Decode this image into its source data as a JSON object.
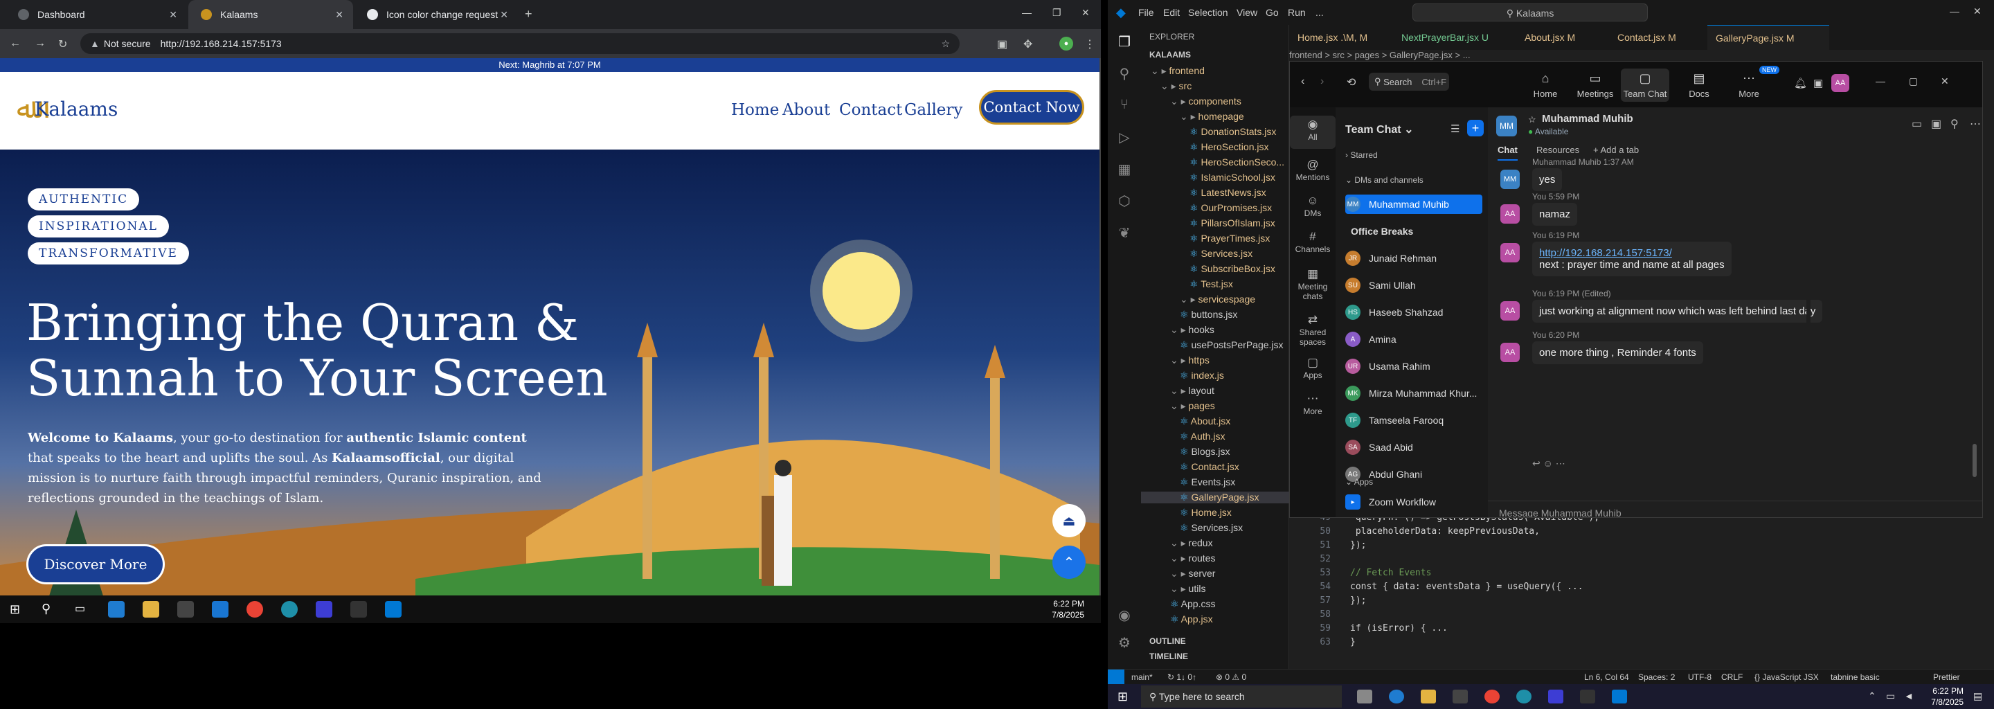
{
  "browser": {
    "tabs": [
      {
        "title": "Dashboard"
      },
      {
        "title": "Kalaams"
      },
      {
        "title": "Icon color change request"
      }
    ],
    "not_secure": "Not secure",
    "url": "http://192.168.214.157:5173"
  },
  "site": {
    "notice": "Next: Maghrib at 7:07 PM",
    "logo": "Kalaams",
    "nav": [
      "Home",
      "About",
      "Contact",
      "Gallery"
    ],
    "contact_button": "Contact Now",
    "pills": [
      "AUTHENTIC",
      "INSPIRATIONAL",
      "TRANSFORMATIVE"
    ],
    "title_line1": "Bringing the Quran &",
    "title_line2": "Sunnah to Your Screen",
    "intro": {
      "b1": "Welcome to Kalaams",
      "t1": ", your go-to destination for ",
      "b2": "authentic Islamic content",
      "t2": " that speaks to the heart and uplifts the soul. As ",
      "b3": "Kalaamsofficial",
      "t3": ", our digital mission is to nurture faith through impactful reminders, Quranic inspiration, and reflections grounded in the teachings of Islam."
    },
    "discover_button": "Discover More"
  },
  "left_taskbar": {
    "time": "6:22 PM",
    "date": "7/8/2025"
  },
  "vscode": {
    "menu": [
      "File",
      "Edit",
      "Selection",
      "View",
      "Go",
      "Run",
      "..."
    ],
    "search": "Kalaams",
    "explorer_title": "EXPLORER",
    "root": "KALAAMS",
    "tree": [
      {
        "label": "frontend",
        "indent": 1,
        "kind": "folder",
        "color": "m"
      },
      {
        "label": "src",
        "indent": 2,
        "kind": "folder",
        "color": "m"
      },
      {
        "label": "components",
        "indent": 3,
        "kind": "folder",
        "color": "m"
      },
      {
        "label": "homepage",
        "indent": 4,
        "kind": "folder",
        "color": "m"
      },
      {
        "label": "DonationStats.jsx",
        "indent": 5,
        "color": "m"
      },
      {
        "label": "HeroSection.jsx",
        "indent": 5,
        "color": "m"
      },
      {
        "label": "HeroSectionSeco...",
        "indent": 5,
        "color": "m"
      },
      {
        "label": "IslamicSchool.jsx",
        "indent": 5,
        "color": "m"
      },
      {
        "label": "LatestNews.jsx",
        "indent": 5,
        "color": "m"
      },
      {
        "label": "OurPromises.jsx",
        "indent": 5,
        "color": "m"
      },
      {
        "label": "PillarsOfIslam.jsx",
        "indent": 5,
        "color": "m"
      },
      {
        "label": "PrayerTimes.jsx",
        "indent": 5,
        "color": "m"
      },
      {
        "label": "Services.jsx",
        "indent": 5,
        "color": "m"
      },
      {
        "label": "SubscribeBox.jsx",
        "indent": 5,
        "color": "m"
      },
      {
        "label": "Test.jsx",
        "indent": 5,
        "color": "m"
      },
      {
        "label": "servicespage",
        "indent": 4,
        "kind": "folder",
        "color": "m"
      },
      {
        "label": "buttons.jsx",
        "indent": 4,
        "color": ""
      },
      {
        "label": "hooks",
        "indent": 3,
        "kind": "folder",
        "color": ""
      },
      {
        "label": "usePostsPerPage.jsx",
        "indent": 4,
        "color": ""
      },
      {
        "label": "https",
        "indent": 3,
        "kind": "folder",
        "color": "m"
      },
      {
        "label": "index.js",
        "indent": 4,
        "color": "m"
      },
      {
        "label": "layout",
        "indent": 3,
        "kind": "folder",
        "color": ""
      },
      {
        "label": "pages",
        "indent": 3,
        "kind": "folder",
        "color": "m"
      },
      {
        "label": "About.jsx",
        "indent": 4,
        "color": "m"
      },
      {
        "label": "Auth.jsx",
        "indent": 4,
        "color": "m"
      },
      {
        "label": "Blogs.jsx",
        "indent": 4,
        "color": ""
      },
      {
        "label": "Contact.jsx",
        "indent": 4,
        "color": "m"
      },
      {
        "label": "Events.jsx",
        "indent": 4,
        "color": ""
      },
      {
        "label": "GalleryPage.jsx",
        "indent": 4,
        "color": "m",
        "selected": true
      },
      {
        "label": "Home.jsx",
        "indent": 4,
        "color": "m"
      },
      {
        "label": "Services.jsx",
        "indent": 4,
        "color": ""
      },
      {
        "label": "redux",
        "indent": 3,
        "kind": "folder",
        "color": ""
      },
      {
        "label": "routes",
        "indent": 3,
        "kind": "folder",
        "color": ""
      },
      {
        "label": "server",
        "indent": 3,
        "kind": "folder",
        "color": ""
      },
      {
        "label": "utils",
        "indent": 3,
        "kind": "folder",
        "color": ""
      },
      {
        "label": "App.css",
        "indent": 3,
        "color": ""
      },
      {
        "label": "App.jsx",
        "indent": 3,
        "color": "m"
      }
    ],
    "outline": "OUTLINE",
    "timeline": "TIMELINE",
    "tabs": [
      "Home.jsx .\\M, M",
      "NextPrayerBar.jsx U",
      "About.jsx M",
      "Contact.jsx M",
      "GalleryPage.jsx M"
    ],
    "breadcrumb": "frontend > src > pages > GalleryPage.jsx > ...",
    "code": [
      {
        "n": "49",
        "t": "  queryFn: () => getPostsByStatus(\"Available\"),"
      },
      {
        "n": "50",
        "t": "  placeholderData: keepPreviousData,"
      },
      {
        "n": "51",
        "t": "});"
      },
      {
        "n": "52",
        "t": ""
      },
      {
        "n": "53",
        "t": "// Fetch Events"
      },
      {
        "n": "54",
        "t": "const { data: eventsData } = useQuery({ ..."
      },
      {
        "n": "57",
        "t": "});"
      },
      {
        "n": "58",
        "t": ""
      },
      {
        "n": "59",
        "t": "if (isError) { ..."
      },
      {
        "n": "63",
        "t": "}"
      }
    ],
    "status_left": [
      "main*",
      "↻ 1↓ 0↑",
      "⊗ 0 ⚠ 0"
    ],
    "status_right": [
      "Ln 6, Col 64",
      "Spaces: 2",
      "UTF-8",
      "CRLF",
      "{} JavaScript JSX",
      "tabnine basic",
      "Prettier"
    ]
  },
  "teams": {
    "search": "Search",
    "shortcut": "Ctrl+F",
    "top_nav": [
      "Home",
      "Meetings",
      "Team Chat",
      "Docs",
      "More"
    ],
    "new_badge": "NEW",
    "user_initials": "AA",
    "rail": [
      "All",
      "Mentions",
      "DMs",
      "Channels",
      "Meeting chats",
      "Shared spaces",
      "Apps",
      "More"
    ],
    "list_title": "Team Chat",
    "starred": "Starred",
    "dms_header": "DMs and channels",
    "contacts": [
      {
        "name": "Muhammad Muhib",
        "initials": "MM",
        "color": "#3b82c4",
        "selected": true
      },
      {
        "name": "Office Breaks",
        "initials": "",
        "color": "",
        "bold": true
      },
      {
        "name": "Junaid Rehman",
        "initials": "JR",
        "color": "#c77d2e"
      },
      {
        "name": "Sami Ullah",
        "initials": "SU",
        "color": "#c77d2e"
      },
      {
        "name": "Haseeb Shahzad",
        "initials": "HS",
        "color": "#2e9a8c"
      },
      {
        "name": "Amina",
        "initials": "A",
        "color": "#8a5cc7"
      },
      {
        "name": "Usama Rahim",
        "initials": "UR",
        "color": "#b85c9e"
      },
      {
        "name": "Mirza Muhammad Khur...",
        "initials": "MK",
        "color": "#3b9a5c"
      },
      {
        "name": "Tamseela Farooq",
        "initials": "TF",
        "color": "#2e9a8c"
      },
      {
        "name": "Saad Abid",
        "initials": "SA",
        "color": "#9a4c5c"
      },
      {
        "name": "Abdul Ghani",
        "initials": "AG",
        "color": "#777"
      }
    ],
    "apps_header": "Apps",
    "zoom_workflow": "Zoom Workflow",
    "chat": {
      "name": "Muhammad Muhib",
      "status": "Available",
      "tabs": [
        "Chat",
        "Resources",
        "+ Add a tab"
      ],
      "messages": [
        {
          "meta": "Muhammad Muhib 1:37 AM",
          "text": "yes",
          "initials": "MM"
        },
        {
          "meta": "You 5:59 PM",
          "text": "namaz",
          "initials": "AA"
        },
        {
          "meta": "You 6:19 PM",
          "link": "http://192.168.214.157:5173/",
          "text": "next : prayer time and name at all pages",
          "initials": "AA"
        },
        {
          "meta": "You 6:19 PM (Edited)",
          "text": "just working at alignment now which was left behind last day",
          "initials": "AA"
        },
        {
          "meta": "You 6:20 PM",
          "text": "one more thing , Reminder 4 fonts",
          "initials": "AA"
        }
      ],
      "composer_placeholder": "Message Muhammad Muhib"
    }
  },
  "right_taskbar": {
    "search_placeholder": "Type here to search",
    "time": "6:22 PM",
    "date": "7/8/2025"
  },
  "colors": {
    "brand_blue": "#1a3f94",
    "gold": "#c8931f",
    "vscode_modified": "#e2c08d",
    "teams_accent": "#0e71eb"
  }
}
